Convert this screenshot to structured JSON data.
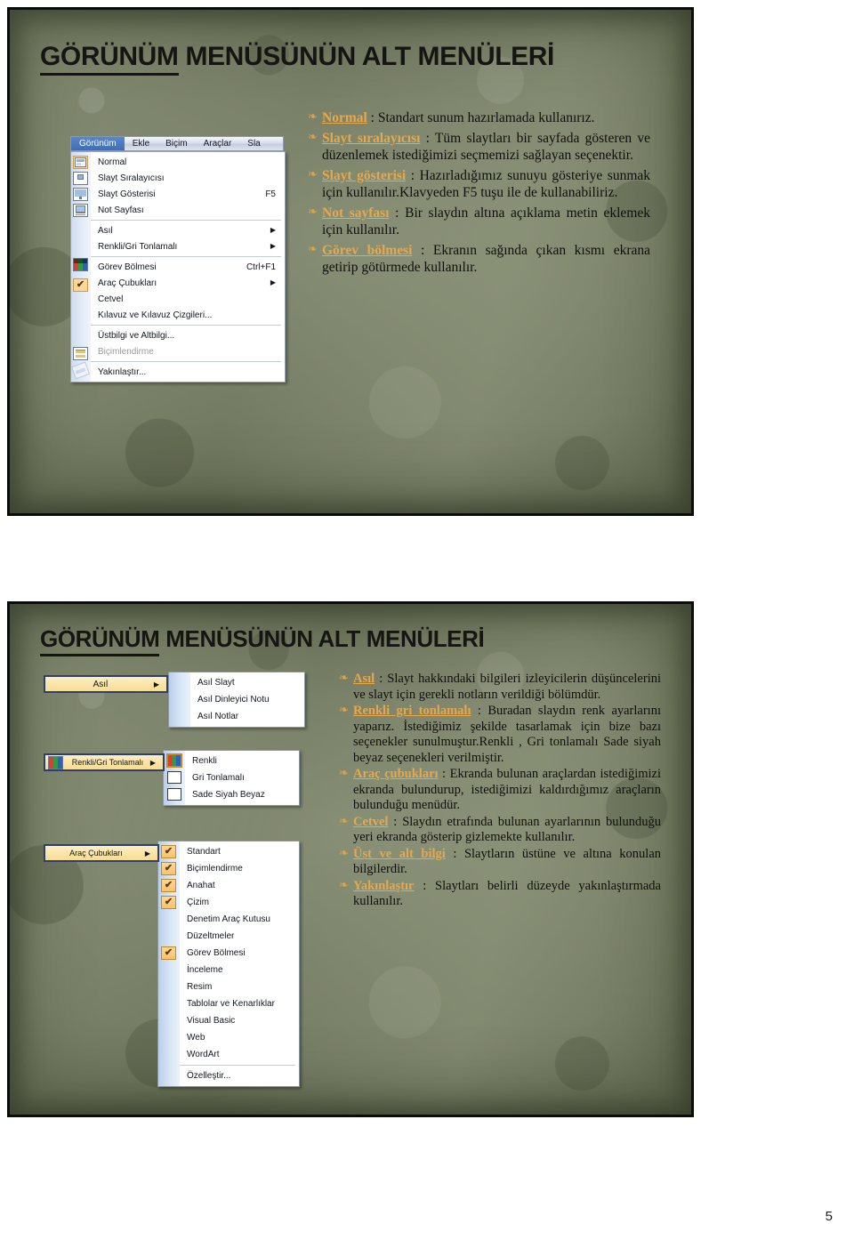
{
  "page": {
    "number": "5",
    "background": "#ffffff"
  },
  "theme": {
    "slide_bg": "#7c8469",
    "keyword_color": "#e8a84a",
    "bullet_color": "#e0a244",
    "title_color": "#151512"
  },
  "slide1": {
    "title": "GÖRÜNÜM MENÜSÜNÜN ALT MENÜLERİ",
    "title_underlined_part": "GÖRÜNÜM",
    "title_rest": " MENÜSÜNÜN ALT MENÜLERİ",
    "menubar": [
      {
        "label": "Görünüm",
        "active": true
      },
      {
        "label": "Ekle",
        "active": false
      },
      {
        "label": "Biçim",
        "active": false
      },
      {
        "label": "Araçlar",
        "active": false
      },
      {
        "label": "Sla",
        "active": false
      }
    ],
    "menu_items": [
      {
        "label": "Normal",
        "accel": "",
        "arrow": "",
        "icon": "normal-icon",
        "disabled": false
      },
      {
        "label": "Slayt Sıralayıcısı",
        "accel": "",
        "arrow": "",
        "icon": "sorter-icon",
        "disabled": false
      },
      {
        "label": "Slayt Gösterisi",
        "accel": "F5",
        "arrow": "",
        "icon": "show-icon",
        "disabled": false
      },
      {
        "label": "Not Sayfası",
        "accel": "",
        "arrow": "",
        "icon": "note-icon",
        "disabled": false
      },
      {
        "separator": true
      },
      {
        "label": "Asıl",
        "accel": "",
        "arrow": "▶",
        "icon": "",
        "disabled": false
      },
      {
        "label": "Renkli/Gri Tonlamalı",
        "accel": "",
        "arrow": "▶",
        "icon": "color-icon",
        "disabled": false
      },
      {
        "separator": true
      },
      {
        "label": "Görev Bölmesi",
        "accel": "Ctrl+F1",
        "arrow": "",
        "icon": "check-icon",
        "disabled": false
      },
      {
        "label": "Araç Çubukları",
        "accel": "",
        "arrow": "▶",
        "icon": "",
        "disabled": false
      },
      {
        "label": "Cetvel",
        "accel": "",
        "arrow": "",
        "icon": "",
        "disabled": false
      },
      {
        "label": "Kılavuz ve Kılavuz Çizgileri...",
        "accel": "",
        "arrow": "",
        "icon": "",
        "disabled": false
      },
      {
        "separator": true
      },
      {
        "label": "Üstbilgi ve Altbilgi...",
        "accel": "",
        "arrow": "",
        "icon": "header-icon",
        "disabled": false
      },
      {
        "label": "Biçimlendirme",
        "accel": "",
        "arrow": "",
        "icon": "format-icon",
        "disabled": true
      },
      {
        "separator": true
      },
      {
        "label": "Yakınlaştır...",
        "accel": "",
        "arrow": "",
        "icon": "",
        "disabled": false
      }
    ],
    "paragraphs": [
      {
        "bullet": "❧",
        "keyword": "Normal",
        "text": " : Standart sunum hazırlamada kullanırız."
      },
      {
        "bullet": "❧",
        "keyword": "Slayt sıralayıcısı",
        "text": " : Tüm slaytları bir sayfada gösteren ve düzenlemek istediğimizi seçmemizi sağlayan seçenektir."
      },
      {
        "bullet": "❧",
        "keyword": "Slayt gösterisi",
        "text": " : Hazırladığımız sunuyu gösteriye sunmak için kullanılır.Klavyeden F5 tuşu ile de kullanabiliriz."
      },
      {
        "bullet": "❧",
        "keyword": "Not sayfası",
        "text": " : Bir slaydın altına açıklama metin eklemek için kullanılır."
      },
      {
        "bullet": "❧",
        "keyword": "Görev bölmesi",
        "text": " : Ekranın sağında çıkan kısmı ekrana getirip götürmede kullanılır."
      }
    ]
  },
  "slide2": {
    "title": "GÖRÜNÜM MENÜSÜNÜN ALT MENÜLERİ",
    "title_underlined_part": "GÖRÜNÜM",
    "title_rest": " MENÜSÜNÜN ALT MENÜLERİ",
    "parents": [
      {
        "label": "Asıl",
        "arrow": "▶",
        "icon": ""
      },
      {
        "label": "Renkli/Gri Tonlamalı",
        "arrow": "▶",
        "icon": "color-icon"
      },
      {
        "label": "Araç Çubukları",
        "arrow": "▶",
        "icon": ""
      }
    ],
    "submenu_asil": [
      {
        "label": "Asıl Slayt",
        "checked": false,
        "icon": ""
      },
      {
        "label": "Asıl Dinleyici Notu",
        "checked": false,
        "icon": ""
      },
      {
        "label": "Asıl Notlar",
        "checked": false,
        "icon": ""
      }
    ],
    "submenu_renkli": [
      {
        "label": "Renkli",
        "checked": false,
        "icon": "color-icon"
      },
      {
        "label": "Gri Tonlamalı",
        "checked": false,
        "icon": "grayscale-icon"
      },
      {
        "label": "Sade Siyah Beyaz",
        "checked": false,
        "icon": "blackwhite-icon"
      }
    ],
    "submenu_arac": [
      {
        "label": "Standart",
        "checked": true
      },
      {
        "label": "Biçimlendirme",
        "checked": true
      },
      {
        "label": "Anahat",
        "checked": true
      },
      {
        "label": "Çizim",
        "checked": true
      },
      {
        "label": "Denetim Araç Kutusu",
        "checked": false
      },
      {
        "label": "Düzeltmeler",
        "checked": false
      },
      {
        "label": "Görev Bölmesi",
        "checked": true
      },
      {
        "label": "İnceleme",
        "checked": false
      },
      {
        "label": "Resim",
        "checked": false
      },
      {
        "label": "Tablolar ve Kenarlıklar",
        "checked": false
      },
      {
        "label": "Visual Basic",
        "checked": false
      },
      {
        "label": "Web",
        "checked": false
      },
      {
        "label": "WordArt",
        "checked": false
      },
      {
        "separator": true
      },
      {
        "label": "Özelleştir...",
        "checked": false
      }
    ],
    "paragraphs": [
      {
        "bullet": "❧",
        "keyword": "Asıl",
        "text": " : Slayt hakkındaki bilgileri izleyicilerin düşüncelerini ve slayt için gerekli notların verildiği bölümdür."
      },
      {
        "bullet": "❧",
        "keyword": "Renkli gri tonlamalı",
        "text": " : Buradan slaydın renk ayarlarını yaparız. İstediğimiz şekilde tasarlamak için bize bazı seçenekler sunulmuştur.Renkli , Gri tonlamalı Sade siyah beyaz seçenekleri verilmiştir."
      },
      {
        "bullet": "❧",
        "keyword": "Araç çubukları",
        "text": " : Ekranda bulunan araçlardan istediğimizi ekranda bulundurup, istediğimizi kaldırdığımız araçların bulunduğu menüdür."
      },
      {
        "bullet": "❧",
        "keyword": "Cetvel",
        "text": " : Slaydın etrafında bulunan ayarlarının bulunduğu yeri ekranda gösterip gizlemekte kullanılır."
      },
      {
        "bullet": "❧",
        "keyword": "Üst ve alt bilgi",
        "text": " : Slaytların üstüne ve altına konulan bilgilerdir."
      },
      {
        "bullet": "❧",
        "keyword": "Yakınlaştır",
        "text": " : Slaytları belirli düzeyde yakınlaştırmada kullanılır."
      }
    ]
  }
}
